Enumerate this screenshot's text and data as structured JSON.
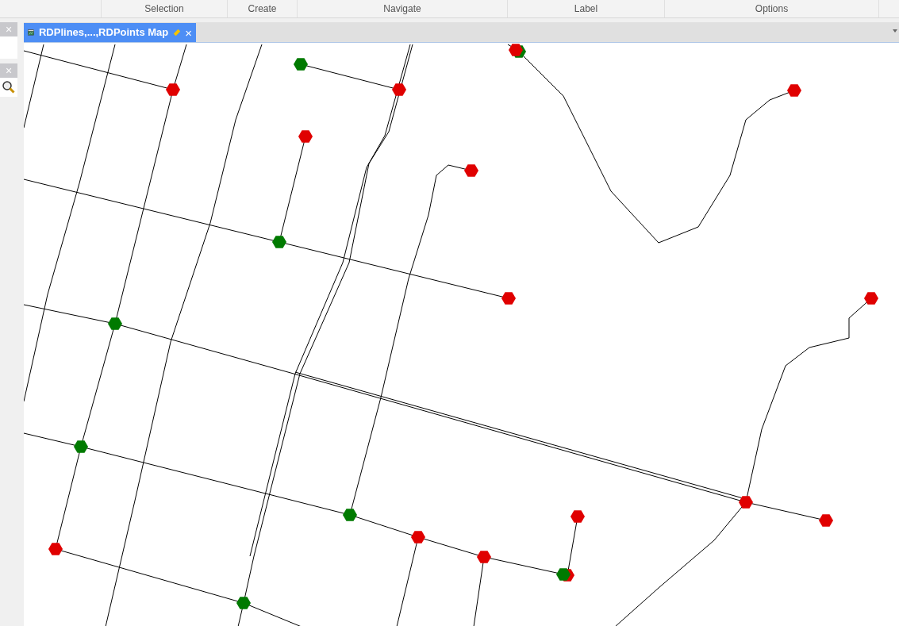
{
  "ribbon": {
    "groups": [
      {
        "label": "Selection"
      },
      {
        "label": "Create"
      },
      {
        "label": "Navigate"
      },
      {
        "label": "Label"
      },
      {
        "label": "Options"
      }
    ]
  },
  "side_panels": [
    {
      "close": "×"
    },
    {
      "close": "×"
    }
  ],
  "tabs": [
    {
      "label": "RDPlines,...,RDPoints Map",
      "selected": true,
      "modified": true,
      "close": "×"
    }
  ],
  "map": {
    "points": [
      {
        "color": "#e00000"
      },
      {
        "color": "#007a00"
      },
      {
        "color": "#e00000"
      },
      {
        "color": "#007a00"
      },
      {
        "color": "#e00000"
      },
      {
        "color": "#e00000"
      },
      {
        "color": "#e00000"
      },
      {
        "color": "#e00000"
      },
      {
        "color": "#007a00"
      },
      {
        "color": "#e00000"
      },
      {
        "color": "#e00000"
      },
      {
        "color": "#007a00"
      },
      {
        "color": "#007a00"
      },
      {
        "color": "#e00000"
      },
      {
        "color": "#e00000"
      },
      {
        "color": "#e00000"
      },
      {
        "color": "#007a00"
      },
      {
        "color": "#e00000"
      },
      {
        "color": "#e00000"
      },
      {
        "color": "#e00000"
      },
      {
        "color": "#e00000"
      },
      {
        "color": "#007a00"
      },
      {
        "color": "#007a00"
      }
    ]
  }
}
